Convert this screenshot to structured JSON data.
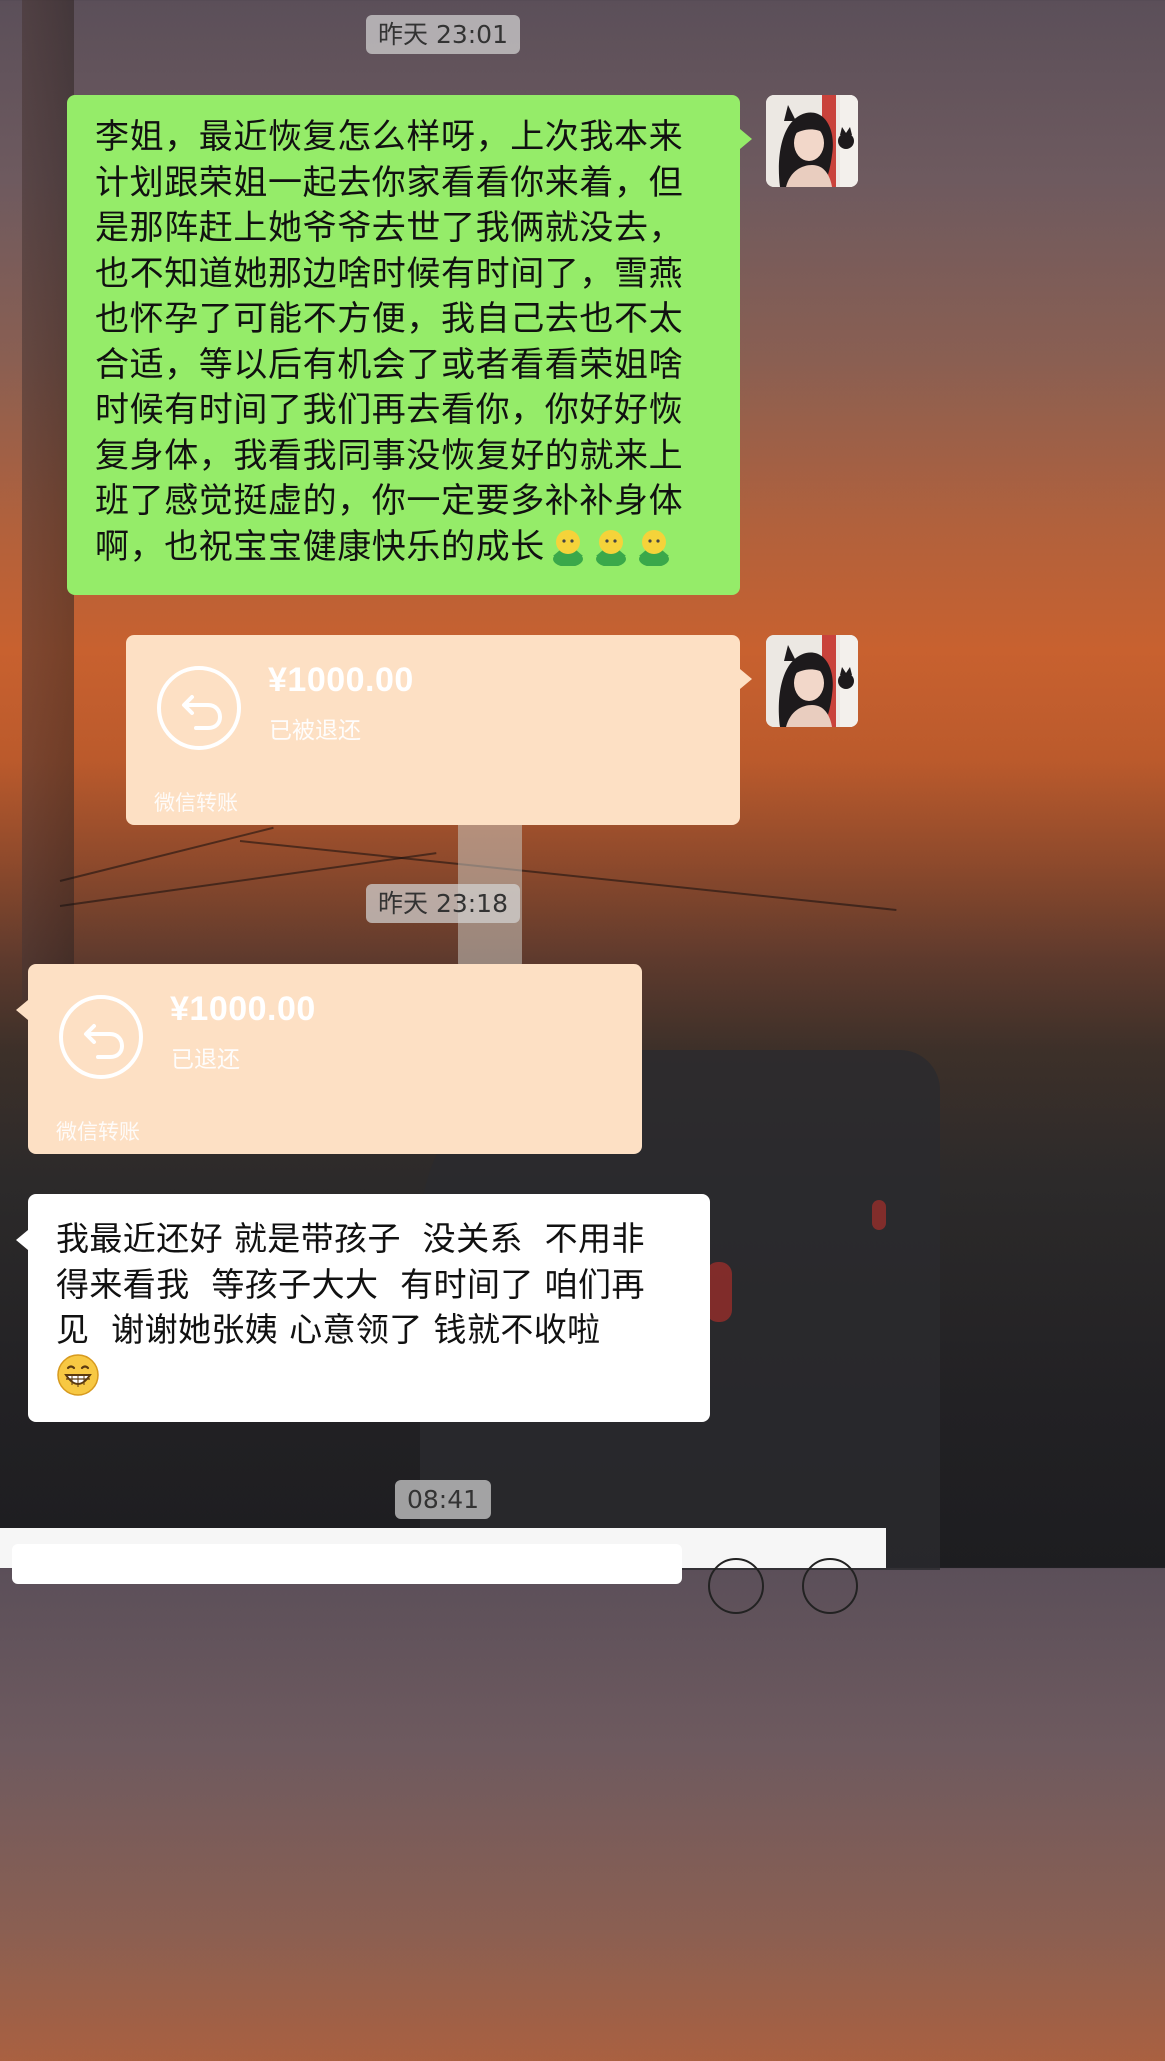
{
  "timestamps": [
    "昨天 23:01",
    "昨天 23:18",
    "08:41"
  ],
  "messages": {
    "sent_text_lines": [
      "李姐，最近恢复怎么样呀，上次我本来",
      "计划跟荣姐一起去你家看看你来着，但",
      "是那阵赶上她爷爷去世了我俩就没去，",
      "也不知道她那边啥时候有时间了，雪燕",
      "也怀孕了可能不方便，我自己去也不太",
      "合适，等以后有机会了或者看看荣姐啥",
      "时候有时间了我们再去看你，你好好恢",
      "复身体，我看我同事没恢复好的就来上",
      "班了感觉挺虚的，你一定要多补补身体",
      "啊，也祝宝宝健康快乐的成长"
    ],
    "sent_transfer": {
      "amount": "¥1000.00",
      "status": "已被退还",
      "footer": "微信转账"
    },
    "received_transfer": {
      "amount": "¥1000.00",
      "status": "已退还",
      "footer": "微信转账"
    },
    "received_text_lines": [
      "我最近还好 就是带孩子  没关系  不用非",
      "得来看我  等孩子大大  有时间了 咱们再",
      "见  谢谢她张姨 心意领了 钱就不收啦"
    ]
  },
  "icons": {
    "sent_text_emoji": "person-emoji",
    "received_text_emoji": "grinning-face-emoji",
    "transfer_icon": "return-arrow-icon",
    "avatar": "user-avatar"
  },
  "colors": {
    "sent_bubble": "#95ec69",
    "received_bubble": "#ffffff",
    "transfer_bubble": "#fde0c4",
    "timestamp_bg": "#d2d2d2"
  }
}
